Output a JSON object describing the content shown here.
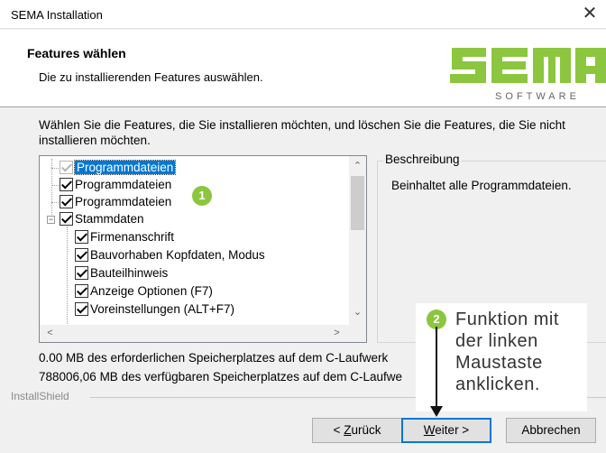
{
  "window": {
    "title": "SEMA Installation",
    "close_glyph": "✕"
  },
  "header": {
    "heading": "Features wählen",
    "subheading": "Die zu installierenden Features auswählen.",
    "logo": {
      "main": "SEMA",
      "sub": "SOFTWARE",
      "color": "#8cc63f"
    }
  },
  "intro": "Wählen Sie die Features, die Sie installieren möchten, und löschen Sie die Features, die Sie nicht installieren möchten.",
  "tree": {
    "items": [
      {
        "label": "Programmdateien",
        "checked": true,
        "dim": true,
        "selected": true,
        "level": 0
      },
      {
        "label": "Programmdateien",
        "checked": true,
        "level": 0
      },
      {
        "label": "Programmdateien",
        "checked": true,
        "level": 0
      },
      {
        "label": "Stammdaten",
        "checked": true,
        "level": 0,
        "expander": "−"
      },
      {
        "label": "Firmenanschrift",
        "checked": true,
        "level": 1
      },
      {
        "label": "Bauvorhaben Kopfdaten, Modus",
        "checked": true,
        "level": 1
      },
      {
        "label": "Bauteilhinweis",
        "checked": true,
        "level": 1
      },
      {
        "label": "Anzeige Optionen (F7)",
        "checked": true,
        "level": 1
      },
      {
        "label": "Voreinstellungen (ALT+F7)",
        "checked": true,
        "level": 1
      }
    ]
  },
  "description": {
    "legend": "Beschreibung",
    "text": "Beinhaltet alle Programmdateien."
  },
  "space": {
    "required": "0.00 MB des erforderlichen Speicherplatzes auf dem C-Laufwerk",
    "available": "788006,06 MB des verfügbaren Speicherplatzes auf dem C-Laufwe"
  },
  "installshield": "InstallShield",
  "buttons": {
    "back_prefix": "< ",
    "back_underlined": "Z",
    "back_rest": "urück",
    "next_underlined": "W",
    "next_rest": "eiter >",
    "cancel": "Abbrechen"
  },
  "annotations": {
    "badge1": "1",
    "badge2": "2",
    "callout_lines": [
      "Funktion mit",
      "der linken",
      "Maustaste",
      "anklicken."
    ],
    "accent_color": "#8cc63f"
  },
  "scroll_glyphs": {
    "up": "⌃",
    "down": "⌄",
    "left": "<",
    "right": ">"
  }
}
